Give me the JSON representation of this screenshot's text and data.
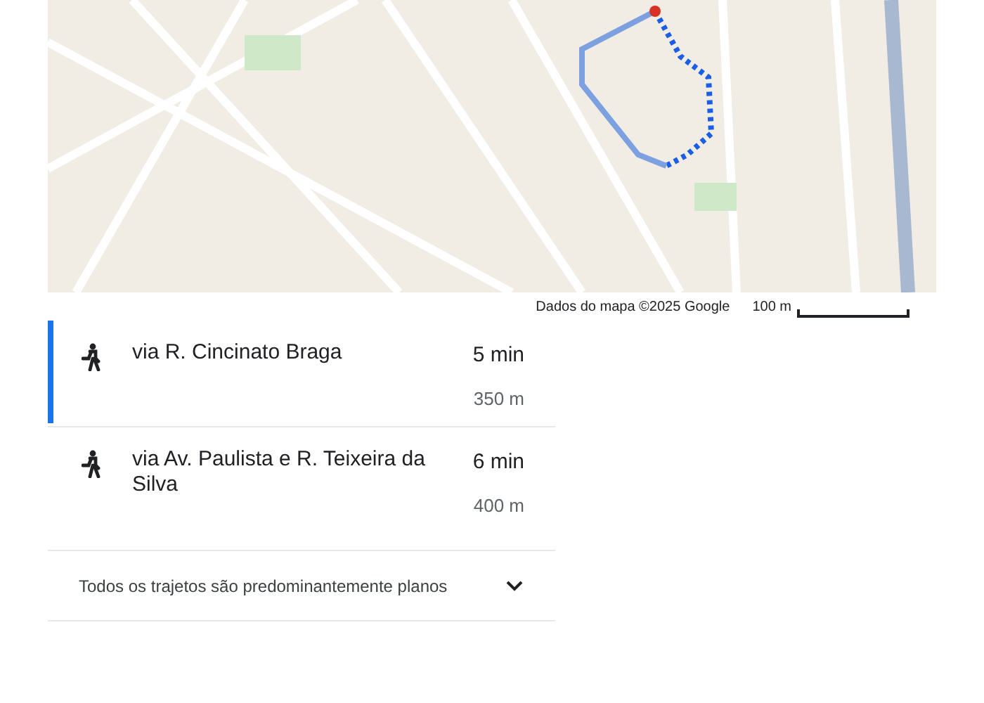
{
  "map": {
    "attribution": "Dados do mapa ©2025 Google",
    "scale": "100 m"
  },
  "routes": [
    {
      "name": "via R. Cincinato Braga",
      "duration": "5 min",
      "distance": "350 m",
      "selected": true
    },
    {
      "name": "via Av. Paulista e R. Teixeira da Silva",
      "duration": "6 min",
      "distance": "400 m",
      "selected": false
    }
  ],
  "note": {
    "text": "Todos os trajetos são predominantemente planos",
    "expanded": false
  }
}
